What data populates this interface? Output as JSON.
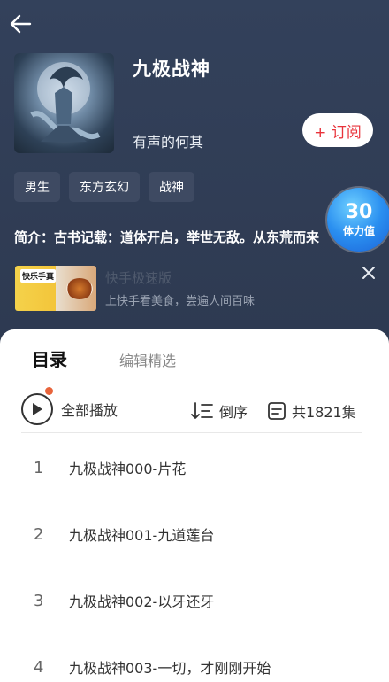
{
  "book": {
    "title": "九极战神",
    "author": "有声的何其",
    "subscribe_label": "+ 订阅",
    "tags": [
      "男生",
      "东方玄幻",
      "战神"
    ],
    "intro": "简介：古书记载：道体开启，举世无敌。从东荒而来"
  },
  "energy": {
    "value": "30",
    "label": "体力值"
  },
  "ad": {
    "thumb_text": "快乐手真",
    "title": "快手极速版",
    "desc": "上快手看美食，尝遍人间百味"
  },
  "tabs": [
    "目录",
    "编辑精选"
  ],
  "toolbar": {
    "play_all": "全部播放",
    "sort": "倒序",
    "count": "共1821集"
  },
  "episodes": [
    {
      "num": "1",
      "title": "九极战神000-片花"
    },
    {
      "num": "2",
      "title": "九极战神001-九道莲台"
    },
    {
      "num": "3",
      "title": "九极战神002-以牙还牙"
    },
    {
      "num": "4",
      "title": "九极战神003-一切，才刚刚开始"
    }
  ],
  "colors": {
    "header_bg": "#2f3b52",
    "accent_red": "#e8333b",
    "tab_dot": "#e8643b",
    "energy_blue": "#2a8ff0"
  }
}
